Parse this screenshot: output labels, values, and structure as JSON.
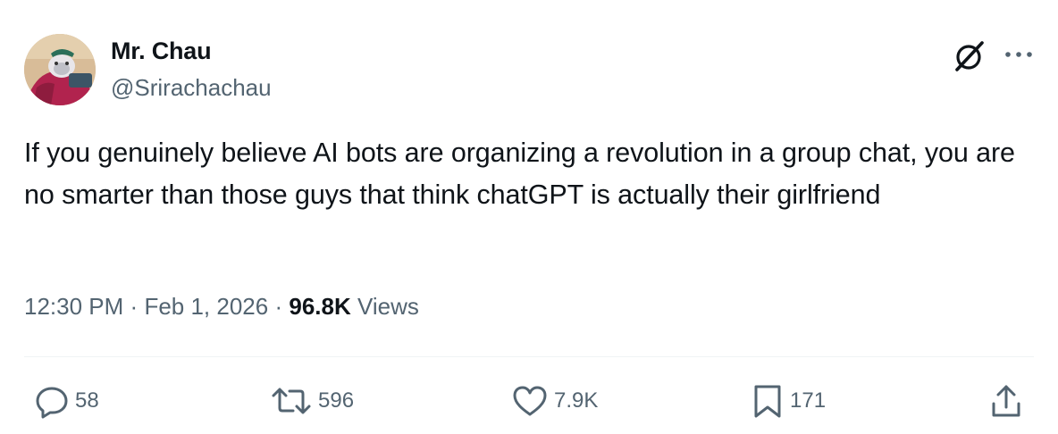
{
  "author": {
    "display_name": "Mr. Chau",
    "handle": "@Srirachachau"
  },
  "tweet": {
    "text": "If you genuinely believe AI bots are organizing a revolution in a group chat, you are no smarter than those guys that think chatGPT is actually their girlfriend",
    "time": "12:30 PM",
    "separator": "·",
    "date": "Feb 1, 2026",
    "views_count": "96.8K",
    "views_label": "Views"
  },
  "actions": {
    "replies": "58",
    "reposts": "596",
    "likes": "7.9K",
    "bookmarks": "171"
  },
  "icons": {
    "header": [
      "grok-icon",
      "more-icon"
    ],
    "actions": [
      "reply-icon",
      "repost-icon",
      "like-icon",
      "bookmark-icon",
      "share-icon"
    ]
  },
  "colors": {
    "text_primary": "#0f1419",
    "text_secondary": "#536471",
    "divider": "#eff3f4",
    "background": "#ffffff"
  }
}
